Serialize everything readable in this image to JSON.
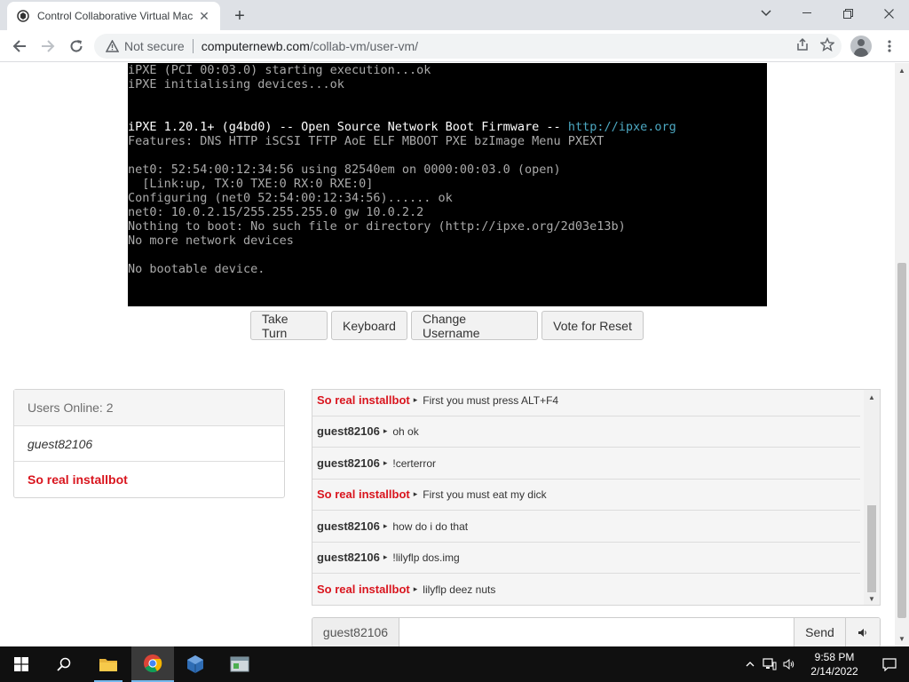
{
  "browser": {
    "tab_title": "Control Collaborative Virtual Mac",
    "tab_close": "✕",
    "new_tab": "+",
    "address": {
      "security": "Not secure",
      "host": "computernewb.com",
      "path": "/collab-vm/user-vm/"
    }
  },
  "vm_console": {
    "lines": [
      "iPXE (PCI 00:03.0) starting execution...ok",
      "iPXE initialising devices...ok",
      "",
      "",
      "",
      "Features: DNS HTTP iSCSI TFTP AoE ELF MBOOT PXE bzImage Menu PXEXT",
      "",
      "net0: 52:54:00:12:34:56 using 82540em on 0000:00:03.0 (open)",
      "  [Link:up, TX:0 TXE:0 RX:0 RXE:0]",
      "Configuring (net0 52:54:00:12:34:56)...... ok",
      "net0: 10.0.2.15/255.255.255.0 gw 10.0.2.2",
      "Nothing to boot: No such file or directory (http://ipxe.org/2d03e13b)",
      "No more network devices",
      "",
      "No bootable device."
    ],
    "banner": {
      "version": "iPXE 1.20.1+ (g4bd0)",
      "middle": " -- Open Source Network Boot Firmware -- ",
      "link": "http://ipxe.org"
    }
  },
  "vm_buttons": {
    "take_turn": "Take Turn",
    "keyboard": "Keyboard",
    "change_username": "Change Username",
    "vote_reset": "Vote for Reset"
  },
  "users": {
    "header": "Users Online: 2",
    "list": [
      {
        "name": "guest82106",
        "type": "guest"
      },
      {
        "name": "So real installbot",
        "type": "registered"
      }
    ]
  },
  "chat": {
    "messages": [
      {
        "user": "So real installbot",
        "highlight": true,
        "text": "First you must press ALT+F4"
      },
      {
        "user": "guest82106",
        "highlight": false,
        "text": "oh ok"
      },
      {
        "user": "guest82106",
        "highlight": false,
        "text": "!certerror"
      },
      {
        "user": "So real installbot",
        "highlight": true,
        "text": "First you must eat my dick"
      },
      {
        "user": "guest82106",
        "highlight": false,
        "text": "how do i do that"
      },
      {
        "user": "guest82106",
        "highlight": false,
        "text": "!lilyflp dos.img"
      },
      {
        "user": "So real installbot",
        "highlight": true,
        "text": "lilyflp deez nuts"
      }
    ],
    "input": {
      "username": "guest82106",
      "value": "",
      "send": "Send"
    }
  },
  "taskbar": {
    "time": "9:58 PM",
    "date": "2/14/2022"
  }
}
